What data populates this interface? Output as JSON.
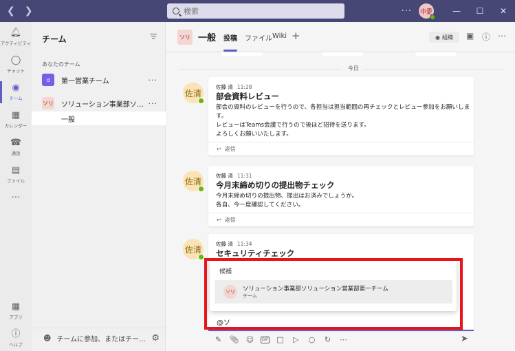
{
  "titlebar": {
    "search_placeholder": "検索",
    "more": "···",
    "user_initials": "中愛",
    "minimize": "—",
    "maximize": "☐",
    "close": "✕"
  },
  "rail": {
    "items": [
      {
        "label": "アクティビティ",
        "icon": "bell-icon"
      },
      {
        "label": "チャット",
        "icon": "chat-icon"
      },
      {
        "label": "チーム",
        "icon": "teams-icon"
      },
      {
        "label": "カレンダー",
        "icon": "calendar-icon"
      },
      {
        "label": "通話",
        "icon": "phone-icon"
      },
      {
        "label": "ファイル",
        "icon": "file-icon"
      }
    ],
    "more": "···",
    "apps_label": "アプリ",
    "help_label": "ヘルプ"
  },
  "teams_pane": {
    "title": "チーム",
    "section": "あなたのチーム",
    "teams": [
      {
        "initial": "d",
        "name": "第一営業チーム",
        "color": "#7160e8",
        "text_color": "#ffffff"
      },
      {
        "initial": "ソリ",
        "name": "ソリューション事業部ソリュー...",
        "color": "#f3d6d2",
        "text_color": "#a4262c"
      }
    ],
    "channel": "一般",
    "team_more": "···",
    "footer": "チームに参加、またはチームを..."
  },
  "channel_header": {
    "avatar": "ソリ",
    "name": "一般",
    "tabs": [
      "投稿",
      "ファイル",
      "Wiki"
    ],
    "add": "+",
    "org_label": "組織"
  },
  "date_separator": "今日",
  "posts": [
    {
      "avatar": "佐清",
      "author": "佐藤 清",
      "time": "11:28",
      "title": "部会資料レビュー",
      "body": [
        "部会の資料のレビューを行うので、各担当は担当範囲の再チェックとレビュー参加をお願いしま",
        "す。",
        "レビューはTeams会議で行うので後ほど招待を送ります。",
        "よろしくお願いいたします。"
      ],
      "reply": "返信"
    },
    {
      "avatar": "佐清",
      "author": "佐藤 清",
      "time": "11:31",
      "title": "今月末締め切りの提出物チェック",
      "body": [
        "今月末締め切りの提出物、提出はお済みでしょうか。",
        "各自、今一度確認してください。"
      ],
      "reply": "返信"
    },
    {
      "avatar": "佐清",
      "author": "佐藤 清",
      "time": "11:34",
      "title": "セキュリティチェック",
      "body": [],
      "reply": ""
    }
  ],
  "mention_popup": {
    "heading": "候補",
    "suggestion_avatar": "ソリ",
    "suggestion_name": "ソリューション事業部ソリューション営業部第一チーム",
    "suggestion_type": "チーム"
  },
  "compose": {
    "text": "@ソ"
  },
  "colors": {
    "titlebar": "#464775",
    "accent": "#5b5fc7",
    "highlight": "#e8141c"
  }
}
